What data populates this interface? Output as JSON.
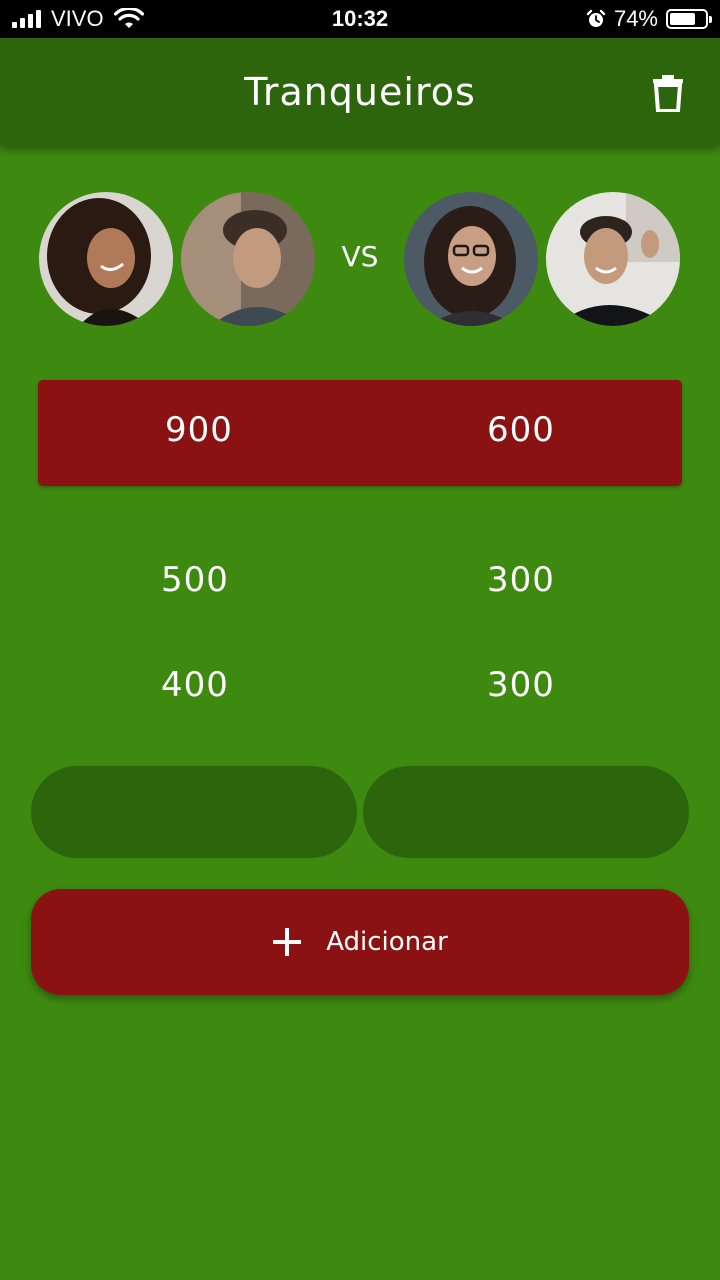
{
  "status_bar": {
    "carrier": "VIVO",
    "time": "10:32",
    "battery_percent": "74%",
    "battery_level": 0.74,
    "icons": [
      "signal-icon",
      "wifi-icon",
      "alarm-icon",
      "battery-icon"
    ]
  },
  "app_bar": {
    "title": "Tranqueiros",
    "action_icon": "trash-icon"
  },
  "match": {
    "vs_label": "VS",
    "team1_players": [
      "player-1",
      "player-2"
    ],
    "team2_players": [
      "player-3",
      "player-4"
    ]
  },
  "scores": {
    "totals": {
      "team1": "900",
      "team2": "600"
    },
    "rounds": [
      {
        "team1": "500",
        "team2": "300"
      },
      {
        "team1": "400",
        "team2": "300"
      }
    ]
  },
  "inputs": {
    "team1_value": "",
    "team2_value": ""
  },
  "add_button": {
    "label": "Adicionar",
    "icon": "plus-icon"
  },
  "colors": {
    "background": "#3e8a10",
    "app_bar": "#2d650c",
    "accent_red": "#8b1212",
    "text": "#ffffff"
  }
}
